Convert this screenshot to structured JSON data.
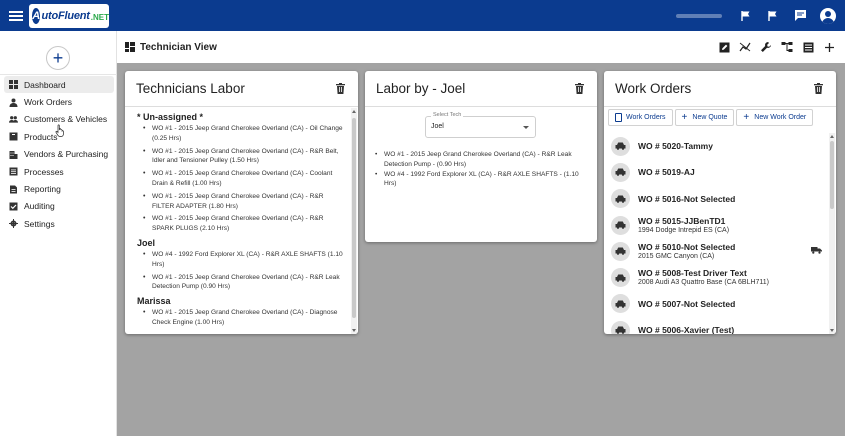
{
  "app": {
    "logo_mark": "A",
    "logo_text": "utoFluent",
    "logo_suffix": ".NET"
  },
  "sidebar": {
    "add_label": "+",
    "items": [
      {
        "label": "Dashboard",
        "icon": "dashboard-icon",
        "active": true
      },
      {
        "label": "Work Orders",
        "icon": "mechanic-icon"
      },
      {
        "label": "Customers & Vehicles",
        "icon": "people-icon"
      },
      {
        "label": "Products",
        "icon": "box-icon"
      },
      {
        "label": "Vendors & Purchasing",
        "icon": "building-icon"
      },
      {
        "label": "Processes",
        "icon": "list-icon"
      },
      {
        "label": "Reporting",
        "icon": "report-icon"
      },
      {
        "label": "Auditing",
        "icon": "auditing-icon"
      },
      {
        "label": "Settings",
        "icon": "gear-icon"
      }
    ]
  },
  "pagebar": {
    "title": "Technician View"
  },
  "technicians_labor": {
    "title": "Technicians Labor",
    "groups": [
      {
        "name": "* Un-assigned *",
        "items": [
          "WO #1 - 2015 Jeep Grand Cherokee Overland (CA) - Oil Change (0.25 Hrs)",
          "WO #1 - 2015 Jeep Grand Cherokee Overland (CA) - R&R Belt, Idler and Tensioner Pulley (1.50 Hrs)",
          "WO #1 - 2015 Jeep Grand Cherokee Overland (CA) - Coolant Drain & Refill (1.00 Hrs)",
          "WO #1 - 2015 Jeep Grand Cherokee Overland (CA) - R&R FILTER ADAPTER (1.80 Hrs)",
          "WO #1 - 2015 Jeep Grand Cherokee Overland (CA) - R&R SPARK PLUGS (2.10 Hrs)"
        ]
      },
      {
        "name": "Joel",
        "items": [
          "WO #4 - 1992 Ford Explorer XL (CA) - R&R AXLE SHAFTS (1.10 Hrs)",
          "WO #1 - 2015 Jeep Grand Cherokee Overland (CA) - R&R Leak Detection Pump (0.90 Hrs)"
        ]
      },
      {
        "name": "Marissa",
        "items": [
          "WO #1 - 2015 Jeep Grand Cherokee Overland (CA) - Diagnose Check Engine (1.00 Hrs)"
        ]
      }
    ]
  },
  "labor_by": {
    "title": "Labor by - Joel",
    "select_label": "Select Tech",
    "select_value": "Joel",
    "items": [
      "WO #1 - 2015 Jeep Grand Cherokee Overland (CA) - R&R Leak Detection Pump - (0.90 Hrs)",
      "WO #4 - 1992 Ford Explorer XL (CA) - R&R AXLE SHAFTS - (1.10 Hrs)"
    ]
  },
  "work_orders": {
    "title": "Work Orders",
    "btn_work_orders": "Work Orders",
    "btn_new_quote": "New Quote",
    "btn_new_work_order": "New Work Order",
    "items": [
      {
        "title": "WO # 5020-Tammy",
        "sub": ""
      },
      {
        "title": "WO # 5019-AJ",
        "sub": ""
      },
      {
        "title": "WO # 5016-Not Selected",
        "sub": ""
      },
      {
        "title": "WO # 5015-JJBenTD1",
        "sub": "1994 Dodge Intrepid ES (CA)"
      },
      {
        "title": "WO # 5010-Not Selected",
        "sub": "2015 GMC Canyon (CA)",
        "truck": true
      },
      {
        "title": "WO # 5008-Test Driver Text",
        "sub": "2008 Audi A3 Quattro Base (CA 6BLH711)"
      },
      {
        "title": "WO # 5007-Not Selected",
        "sub": ""
      },
      {
        "title": "WO # 5006-Xavier (Test)",
        "sub": ""
      }
    ]
  }
}
